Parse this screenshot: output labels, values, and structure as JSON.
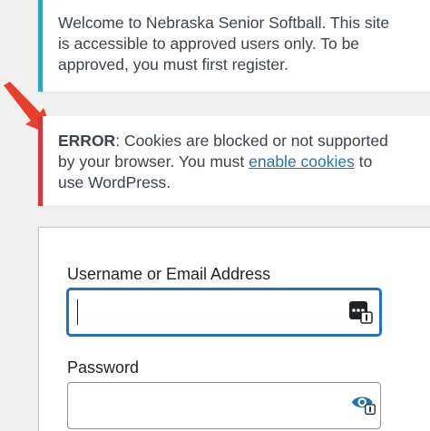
{
  "notices": {
    "info": {
      "line1": "Welcome to Nebraska Senior Softball. This site",
      "line2": "is accessible to approved users only. To be",
      "line3": "approved, you must first register."
    },
    "error": {
      "label": "ERROR",
      "text1": ": Cookies are blocked or not supported",
      "text2": "by your browser. You must ",
      "link": "enable cookies",
      "text3": " to",
      "text4": "use WordPress."
    }
  },
  "login": {
    "username_label": "Username or Email Address",
    "username_value": "",
    "password_label": "Password",
    "password_value": ""
  },
  "icons": {
    "arrow": "red-arrow-icon",
    "password_manager": "password-manager-icon",
    "eye": "show-password-icon"
  },
  "colors": {
    "info_border": "#2ea2cc",
    "error_border": "#d63638",
    "link": "#2271b1",
    "focus": "#2271b1",
    "arrow": "#e8402a"
  }
}
